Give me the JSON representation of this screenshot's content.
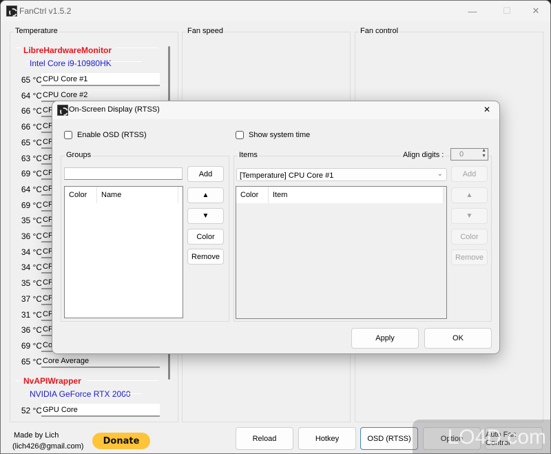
{
  "window": {
    "title": "FanCtrl v1.5.2",
    "minimize": "—",
    "maximize": "☐",
    "close": "✕"
  },
  "groups": {
    "temperature": "Temperature",
    "fan_speed": "Fan speed",
    "fan_control": "Fan control"
  },
  "sensors": {
    "provider1": "LibreHardwareMonitor",
    "device1": "Intel Core i9-10980HK",
    "cpu_rows": [
      {
        "temp": "65 °C",
        "name": "CPU Core #1"
      },
      {
        "temp": "64 °C",
        "name": "CPU Core #2"
      },
      {
        "temp": "66 °C",
        "name": "CP"
      },
      {
        "temp": "66 °C",
        "name": "CP"
      },
      {
        "temp": "65 °C",
        "name": "CP"
      },
      {
        "temp": "63 °C",
        "name": "CP"
      },
      {
        "temp": "69 °C",
        "name": "CP"
      },
      {
        "temp": "64 °C",
        "name": "CP"
      },
      {
        "temp": "69 °C",
        "name": "CP"
      },
      {
        "temp": "35 °C",
        "name": "CP"
      },
      {
        "temp": "36 °C",
        "name": "CP"
      },
      {
        "temp": "34 °C",
        "name": "CP"
      },
      {
        "temp": "34 °C",
        "name": "CP"
      },
      {
        "temp": "35 °C",
        "name": "CP"
      },
      {
        "temp": "37 °C",
        "name": "CP"
      },
      {
        "temp": "31 °C",
        "name": "CP"
      },
      {
        "temp": "36 °C",
        "name": "CP"
      },
      {
        "temp": "69 °C",
        "name": "Co"
      },
      {
        "temp": "65 °C",
        "name": "Core Average"
      }
    ],
    "provider2": "NvAPIWrapper",
    "device2": "NVIDIA GeForce RTX 2060",
    "gpu_rows": [
      {
        "temp": "52 °C",
        "name": "GPU Core"
      }
    ]
  },
  "footer": {
    "made_by": "Made by Lich",
    "email": "(lich426@gmail.com)",
    "donate": "Donate",
    "buttons": [
      "Reload",
      "Hotkey",
      "OSD (RTSS)",
      "Option",
      "Auto Fan Control"
    ]
  },
  "dialog": {
    "title": "On-Screen Display (RTSS)",
    "close": "✕",
    "enable_osd": "Enable OSD (RTSS)",
    "show_time": "Show system time",
    "groups_label": "Groups",
    "group_name_value": "",
    "groups_add": "Add",
    "up": "▲",
    "down": "▼",
    "color": "Color",
    "remove": "Remove",
    "groups_columns": [
      "Color",
      "Name"
    ],
    "items_label": "Items",
    "align_digits_label": "Align digits :",
    "align_digits_value": "0",
    "items_select": "[Temperature] CPU Core #1",
    "items_add": "Add",
    "items_columns": [
      "Color",
      "Item"
    ],
    "apply": "Apply",
    "ok": "OK"
  },
  "watermark": "LO4D.com"
}
